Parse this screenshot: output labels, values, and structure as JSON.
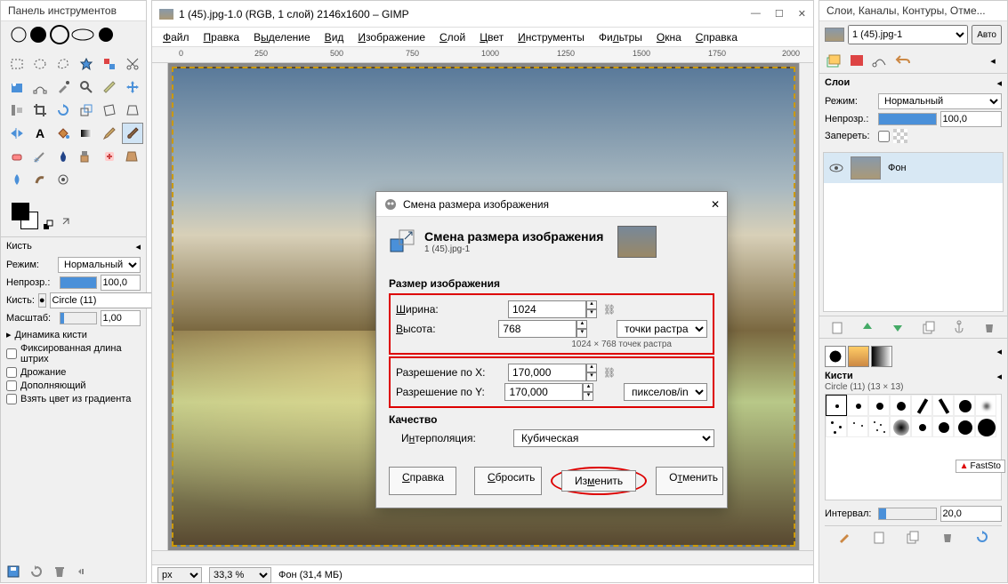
{
  "toolbox": {
    "title": "Панель инструментов",
    "brush_section": "Кисть",
    "mode_label": "Режим:",
    "mode_value": "Нормальный",
    "opacity_label": "Непрозр.:",
    "opacity_value": "100,0",
    "brush_label": "Кисть:",
    "brush_value": "Circle (11)",
    "scale_label": "Масштаб:",
    "scale_value": "1,00",
    "dynamics": "Динамика кисти",
    "opt_fixed": "Фиксированная длина штрих",
    "opt_jitter": "Дрожание",
    "opt_additive": "Дополняющий",
    "opt_gradient": "Взять цвет из градиента"
  },
  "main": {
    "title": "1 (45).jpg-1.0 (RGB, 1 слой) 2146x1600 – GIMP",
    "menu": [
      "Файл",
      "Правка",
      "Выделение",
      "Вид",
      "Изображение",
      "Слой",
      "Цвет",
      "Инструменты",
      "Фильтры",
      "Окна",
      "Справка"
    ],
    "ruler_marks": [
      "0",
      "250",
      "500",
      "750",
      "1000",
      "1250",
      "1500",
      "1750",
      "2000"
    ],
    "status_unit": "px",
    "status_zoom": "33,3 %",
    "status_info": "Фон (31,4 МБ)"
  },
  "dialog": {
    "win_title": "Смена размера изображения",
    "heading": "Смена размера изображения",
    "subtitle": "1 (45).jpg-1",
    "group_size": "Размер изображения",
    "width_label": "Ширина:",
    "width_value": "1024",
    "height_label": "Высота:",
    "height_value": "768",
    "size_hint": "1024 × 768 точек растра",
    "unit_size": "точки растра",
    "resx_label": "Разрешение по X:",
    "resx_value": "170,000",
    "resy_label": "Разрешение по Y:",
    "resy_value": "170,000",
    "unit_res": "пикселов/in",
    "group_quality": "Качество",
    "interp_label": "Интерполяция:",
    "interp_value": "Кубическая",
    "btn_help": "Справка",
    "btn_reset": "Сбросить",
    "btn_apply": "Изменить",
    "btn_cancel": "Отменить"
  },
  "right": {
    "title": "Слои, Каналы, Контуры, Отме...",
    "layer_dropdown": "1 (45).jpg-1",
    "auto_btn": "Авто",
    "layers_heading": "Слои",
    "mode_label": "Режим:",
    "mode_value": "Нормальный",
    "opacity_label": "Непрозр.:",
    "opacity_value": "100,0",
    "lock_label": "Запереть:",
    "layer_name": "Фон",
    "brushes_heading": "Кисти",
    "brush_info": "Circle (11) (13 × 13)",
    "interval_label": "Интервал:",
    "interval_value": "20,0",
    "faststone": "FastSto"
  }
}
